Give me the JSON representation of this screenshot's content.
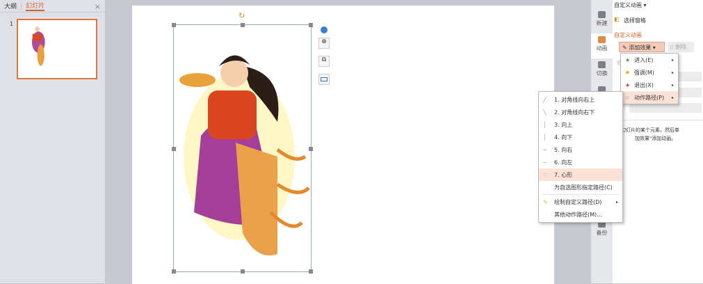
{
  "left_panel": {
    "tabs": [
      "大纲",
      "幻灯片"
    ],
    "active_tab": "幻灯片",
    "close": "×",
    "slide_number": "1"
  },
  "vertical_tabs": [
    "新建",
    "动画",
    "切换",
    "",
    "备份"
  ],
  "panel": {
    "dropdown": "自定义动画 ▾",
    "select_pane": "选择窗格",
    "section_title": "自定义动画",
    "add_effect": "添加效果",
    "delete": "删除",
    "partial_label_modify": "修",
    "partial_label_speed": "速度:",
    "hint_line1": "选中幻灯片的某个元素，然后单",
    "hint_line2": "加效果\"添加动画。"
  },
  "effect_menu": [
    {
      "label": "进入(E)",
      "icon": "green-star"
    },
    {
      "label": "强调(M)",
      "icon": "yellow-star"
    },
    {
      "label": "退出(X)",
      "icon": "red-star"
    },
    {
      "label": "动作路径(P)",
      "icon": "outline-star",
      "highlighted": true
    }
  ],
  "path_menu": [
    {
      "label": "1. 对角线向右上",
      "icon": "diag-up"
    },
    {
      "label": "2. 对角线向右下",
      "icon": "diag-down"
    },
    {
      "label": "3. 向上",
      "icon": "vline"
    },
    {
      "label": "4. 向下",
      "icon": "vline"
    },
    {
      "label": "5. 向右",
      "icon": "hline"
    },
    {
      "label": "6. 向左",
      "icon": "hline"
    },
    {
      "label": "7. 心形",
      "icon": "heart",
      "highlighted": true
    },
    {
      "label": "为自选图形指定路径(C)",
      "icon": ""
    },
    {
      "label": "绘制自定义路径(D)",
      "icon": "pen",
      "submenu": true
    },
    {
      "label": "其他动作路径(M)...",
      "icon": ""
    }
  ],
  "accent": "#d0652f"
}
